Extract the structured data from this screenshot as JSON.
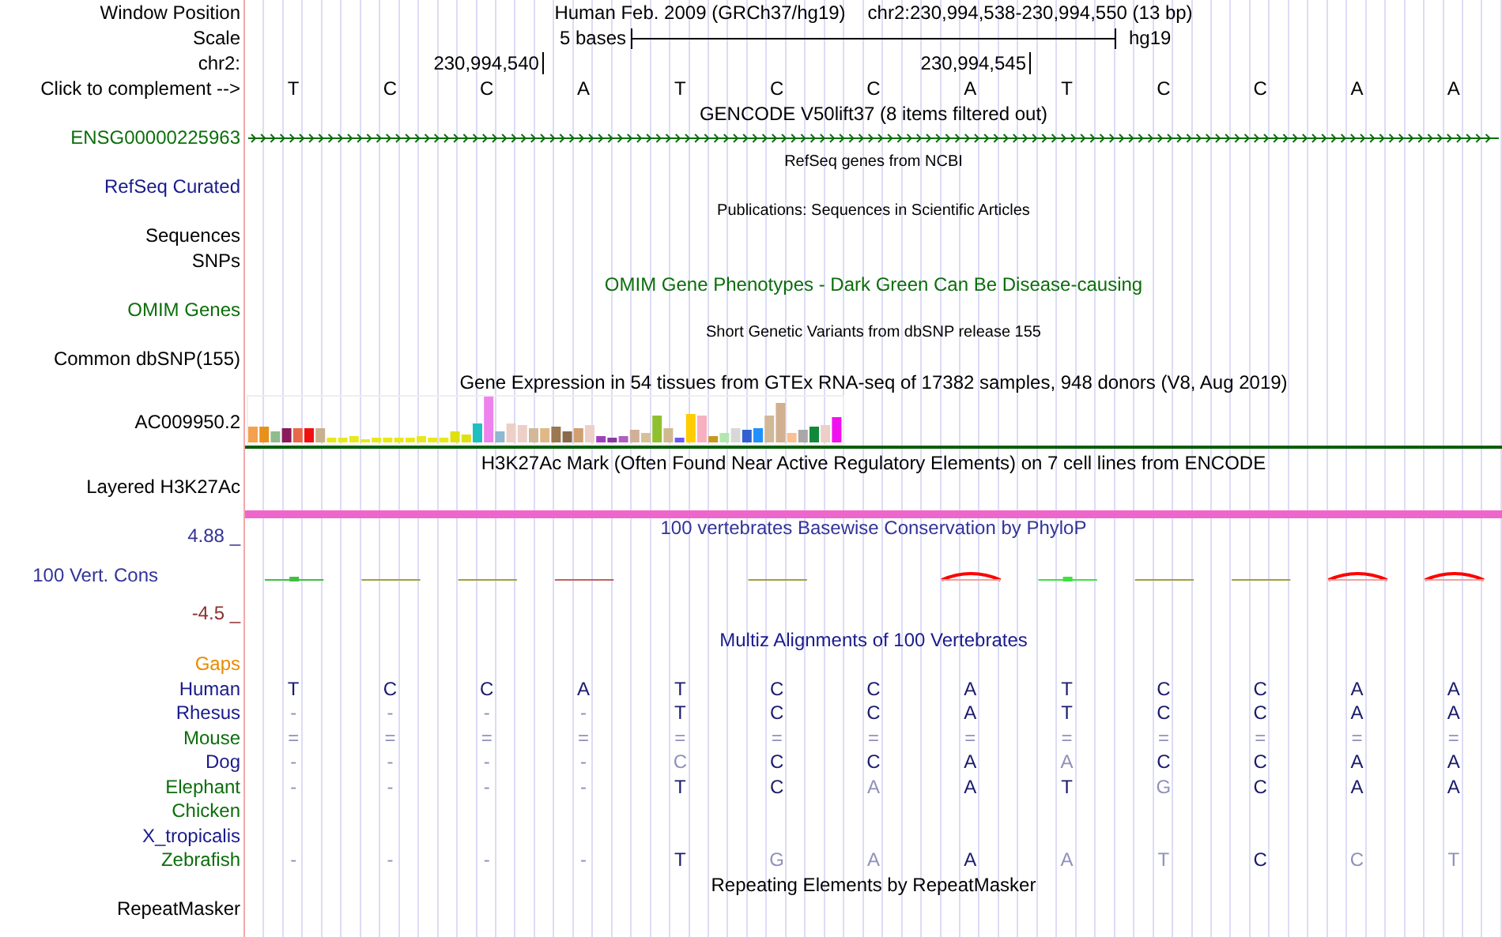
{
  "header": {
    "window_label": "Window Position",
    "assembly": "Human Feb. 2009 (GRCh37/hg19)",
    "position": "chr2:230,994,538-230,994,550 (13 bp)",
    "scale_label": "Scale",
    "scale_text": "5 bases",
    "scale_assembly": "hg19",
    "chrom_label": "chr2:",
    "position_labels": [
      "230,994,540",
      "230,994,545"
    ],
    "complement_label": "Click to complement -->",
    "bases": [
      "T",
      "C",
      "C",
      "A",
      "T",
      "C",
      "C",
      "A",
      "T",
      "C",
      "C",
      "A",
      "A"
    ]
  },
  "tracks": [
    {
      "kind": "gene",
      "title": "GENCODE V50lift37 (8 items filtered out)",
      "labels": [
        {
          "text": "ENSG00000225963",
          "color": "#0b6e0b"
        }
      ]
    },
    {
      "kind": "composite",
      "title": "RefSeq genes from NCBI",
      "labels": [
        {
          "text": "RefSeq Curated",
          "color": "#1a1a8c"
        }
      ]
    },
    {
      "kind": "composite",
      "title": "Publications: Sequences in Scientific Articles",
      "labels": [
        {
          "text": "Sequences",
          "color": "#000000"
        },
        {
          "text": "SNPs",
          "color": "#000000"
        }
      ]
    },
    {
      "kind": "plain",
      "title": "OMIM Gene Phenotypes - Dark Green Can Be Disease-causing",
      "color": "#0b6e0b",
      "labels": [
        {
          "text": "OMIM Genes",
          "color": "#0b6e0b"
        }
      ]
    },
    {
      "kind": "composite",
      "title": "Short Genetic Variants from dbSNP release 155",
      "labels": [
        {
          "text": "Common dbSNP(155)",
          "color": "#000000"
        }
      ]
    },
    {
      "kind": "expression",
      "title": "Gene Expression in 54 tissues from GTEx RNA-seq of 17382 samples, 948 donors (V8, Aug 2019)",
      "labels": [
        {
          "text": "AC009950.2",
          "color": "#000000"
        }
      ]
    },
    {
      "kind": "layered",
      "title": "H3K27Ac Mark (Often Found Near Active Regulatory Elements) on 7 cell lines from ENCODE",
      "labels": [
        {
          "text": "Layered H3K27Ac",
          "color": "#000000"
        }
      ]
    },
    {
      "kind": "conservation",
      "title": "100 vertebrates Basewise Conservation by PhyloP",
      "color": "#333399",
      "max": "4.88 _",
      "min": "-4.5 _",
      "labels": [
        {
          "text": "100 Vert. Cons",
          "color": "#333399"
        }
      ]
    },
    {
      "kind": "alignment",
      "title": "Multiz Alignments of 100 Vertebrates",
      "color": "#1a1a8c",
      "labels": [
        {
          "text": "Gaps",
          "color": "#e88a00"
        }
      ],
      "species": [
        {
          "name": "Human",
          "color": "#1a1a8c",
          "bases": [
            {
              "text": "T",
              "faded": false
            },
            {
              "text": "C",
              "faded": false
            },
            {
              "text": "C",
              "faded": false
            },
            {
              "text": "A",
              "faded": false
            },
            {
              "text": "T",
              "faded": false
            },
            {
              "text": "C",
              "faded": false
            },
            {
              "text": "C",
              "faded": false
            },
            {
              "text": "A",
              "faded": false
            },
            {
              "text": "T",
              "faded": false
            },
            {
              "text": "C",
              "faded": false
            },
            {
              "text": "C",
              "faded": false
            },
            {
              "text": "A",
              "faded": false
            },
            {
              "text": "A",
              "faded": false
            }
          ]
        },
        {
          "name": "Rhesus",
          "color": "#1a1a8c",
          "bases": [
            {
              "text": "-",
              "faded": true
            },
            {
              "text": "-",
              "faded": true
            },
            {
              "text": "-",
              "faded": true
            },
            {
              "text": "-",
              "faded": true
            },
            {
              "text": "T",
              "faded": false
            },
            {
              "text": "C",
              "faded": false
            },
            {
              "text": "C",
              "faded": false
            },
            {
              "text": "A",
              "faded": false
            },
            {
              "text": "T",
              "faded": false
            },
            {
              "text": "C",
              "faded": false
            },
            {
              "text": "C",
              "faded": false
            },
            {
              "text": "A",
              "faded": false
            },
            {
              "text": "A",
              "faded": false
            }
          ]
        },
        {
          "name": "Mouse",
          "color": "#0b6e0b",
          "bases": [
            {
              "text": "=",
              "faded": true
            },
            {
              "text": "=",
              "faded": true
            },
            {
              "text": "=",
              "faded": true
            },
            {
              "text": "=",
              "faded": true
            },
            {
              "text": "=",
              "faded": true
            },
            {
              "text": "=",
              "faded": true
            },
            {
              "text": "=",
              "faded": true
            },
            {
              "text": "=",
              "faded": true
            },
            {
              "text": "=",
              "faded": true
            },
            {
              "text": "=",
              "faded": true
            },
            {
              "text": "=",
              "faded": true
            },
            {
              "text": "=",
              "faded": true
            },
            {
              "text": "=",
              "faded": true
            }
          ]
        },
        {
          "name": "Dog",
          "color": "#1a1a8c",
          "bases": [
            {
              "text": "-",
              "faded": true
            },
            {
              "text": "-",
              "faded": true
            },
            {
              "text": "-",
              "faded": true
            },
            {
              "text": "-",
              "faded": true
            },
            {
              "text": "C",
              "faded": true
            },
            {
              "text": "C",
              "faded": false
            },
            {
              "text": "C",
              "faded": false
            },
            {
              "text": "A",
              "faded": false
            },
            {
              "text": "A",
              "faded": true
            },
            {
              "text": "C",
              "faded": false
            },
            {
              "text": "C",
              "faded": false
            },
            {
              "text": "A",
              "faded": false
            },
            {
              "text": "A",
              "faded": false
            }
          ]
        },
        {
          "name": "Elephant",
          "color": "#0b6e0b",
          "bases": [
            {
              "text": "-",
              "faded": true
            },
            {
              "text": "-",
              "faded": true
            },
            {
              "text": "-",
              "faded": true
            },
            {
              "text": "-",
              "faded": true
            },
            {
              "text": "T",
              "faded": false
            },
            {
              "text": "C",
              "faded": false
            },
            {
              "text": "A",
              "faded": true
            },
            {
              "text": "A",
              "faded": false
            },
            {
              "text": "T",
              "faded": false
            },
            {
              "text": "G",
              "faded": true
            },
            {
              "text": "C",
              "faded": false
            },
            {
              "text": "A",
              "faded": false
            },
            {
              "text": "A",
              "faded": false
            }
          ]
        },
        {
          "name": "Chicken",
          "color": "#0b6e0b"
        },
        {
          "name": "X_tropicalis",
          "color": "#1a1a8c"
        },
        {
          "name": "Zebrafish",
          "color": "#0b6e0b",
          "bases": [
            {
              "text": "-",
              "faded": true
            },
            {
              "text": "-",
              "faded": true
            },
            {
              "text": "-",
              "faded": true
            },
            {
              "text": "-",
              "faded": true
            },
            {
              "text": "T",
              "faded": false
            },
            {
              "text": "G",
              "faded": true
            },
            {
              "text": "A",
              "faded": true
            },
            {
              "text": "A",
              "faded": false
            },
            {
              "text": "A",
              "faded": true
            },
            {
              "text": "T",
              "faded": true
            },
            {
              "text": "C",
              "faded": false
            },
            {
              "text": "C",
              "faded": true
            },
            {
              "text": "T",
              "faded": true
            }
          ]
        }
      ]
    },
    {
      "kind": "plain",
      "title": "Repeating Elements by RepeatMasker",
      "labels": [
        {
          "text": "RepeatMasker",
          "color": "#000000"
        }
      ]
    }
  ]
}
